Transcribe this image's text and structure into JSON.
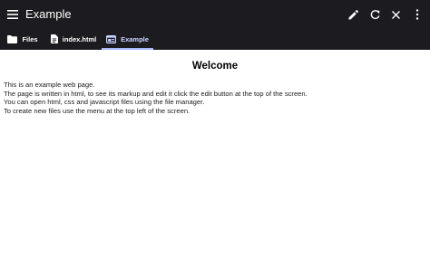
{
  "appbar": {
    "title": "Example",
    "icons": {
      "menu": "menu-icon",
      "edit": "pencil-icon",
      "refresh": "refresh-icon",
      "close": "close-icon",
      "more": "more-vert-icon"
    }
  },
  "tabs": [
    {
      "label": "Files",
      "icon": "folder-icon"
    },
    {
      "label": "index.html",
      "icon": "file-icon"
    },
    {
      "label": "Example",
      "icon": "web-icon",
      "active": true
    }
  ],
  "colors": {
    "toolbar_bg": "#1c1c20",
    "active_tab_accent": "#a9b8ff",
    "page_bg": "#ffffff"
  },
  "page": {
    "heading": "Welcome",
    "lines": [
      "This is an example web page.",
      "The page is written in html, to see its markup and edit it click the edit button at the top of the screen.",
      "You can open html, css and javascript files using the file manager.",
      "To create new files use the menu at the top left of the screen."
    ]
  }
}
